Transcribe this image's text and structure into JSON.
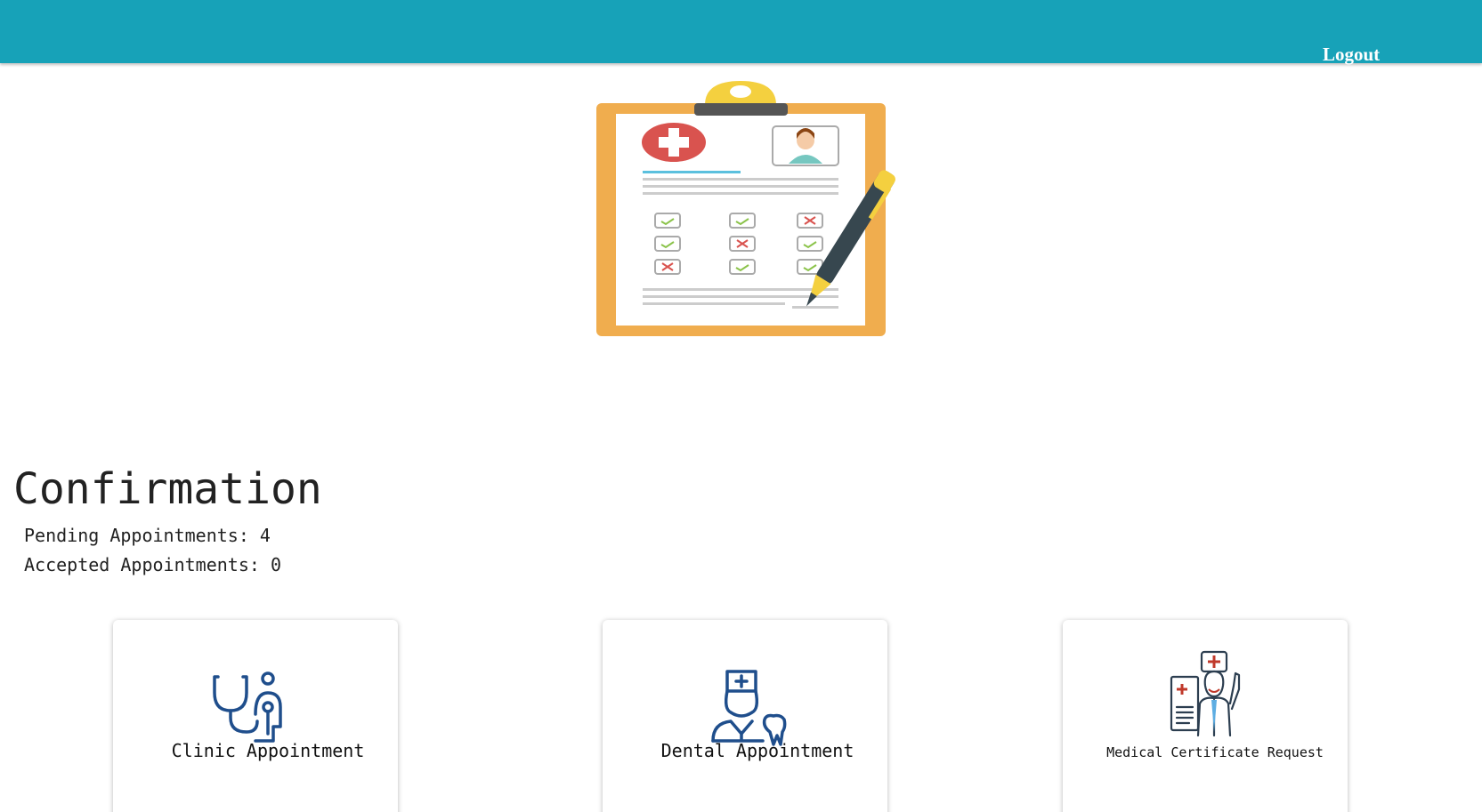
{
  "header": {
    "logout_label": "Logout",
    "bar_color": "#17a2b8"
  },
  "hero": {
    "icon": "clipboard-checklist-icon"
  },
  "confirmation": {
    "title": "Confirmation",
    "pending_label": "Pending Appointments: 4",
    "accepted_label": "Accepted Appointments: 0"
  },
  "cards": [
    {
      "label": "Clinic Appointment",
      "icon": "stethoscope-icon"
    },
    {
      "label": "Dental Appointment",
      "icon": "dental-nurse-icon"
    },
    {
      "label": "Medical Certificate Request",
      "icon": "doctor-certificate-icon"
    }
  ]
}
